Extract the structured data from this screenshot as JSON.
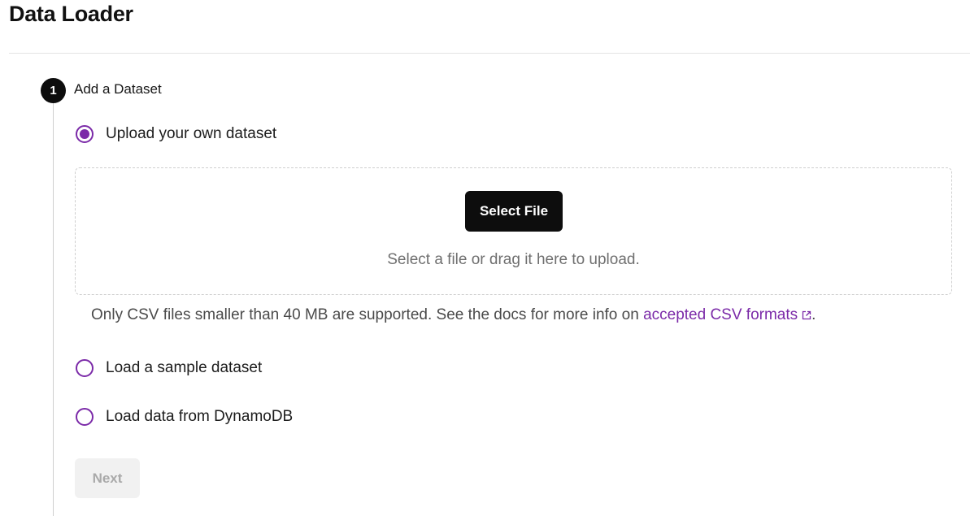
{
  "page": {
    "title": "Data Loader"
  },
  "step": {
    "number": "1",
    "title": "Add a Dataset"
  },
  "options": [
    {
      "label": "Upload your own dataset",
      "selected": true
    },
    {
      "label": "Load a sample dataset",
      "selected": false
    },
    {
      "label": "Load data from DynamoDB",
      "selected": false
    }
  ],
  "upload": {
    "button_label": "Select File",
    "hint": "Select a file or drag it here to upload."
  },
  "help": {
    "text_before": "Only CSV files smaller than 40 MB are supported. See the docs for more info on ",
    "link_text": "accepted CSV formats",
    "text_after": ".",
    "link_icon": "external-link-icon"
  },
  "actions": {
    "next_label": "Next",
    "next_disabled": true
  },
  "colors": {
    "accent": "#7b2aa8",
    "primary_button": "#0d0d0d",
    "disabled_button_bg": "#f1f1f1",
    "disabled_button_text": "#a9a9a9"
  }
}
